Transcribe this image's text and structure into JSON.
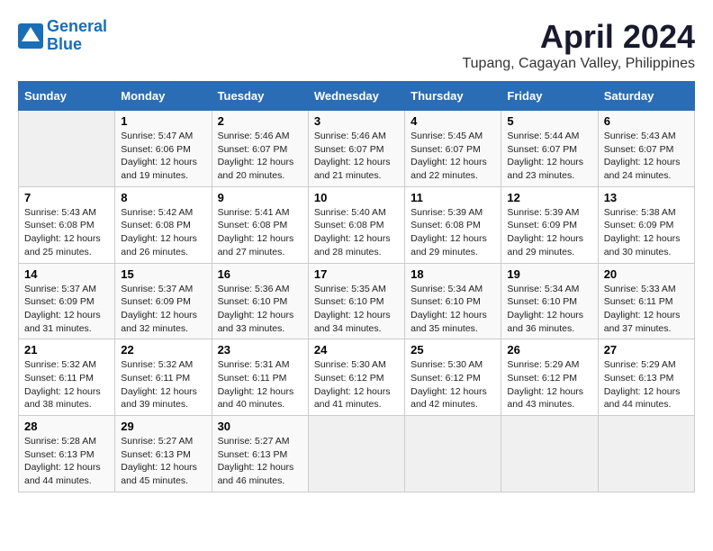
{
  "logo": {
    "line1": "General",
    "line2": "Blue"
  },
  "title": "April 2024",
  "location": "Tupang, Cagayan Valley, Philippines",
  "days_of_week": [
    "Sunday",
    "Monday",
    "Tuesday",
    "Wednesday",
    "Thursday",
    "Friday",
    "Saturday"
  ],
  "weeks": [
    [
      {
        "num": "",
        "info": ""
      },
      {
        "num": "1",
        "info": "Sunrise: 5:47 AM\nSunset: 6:06 PM\nDaylight: 12 hours\nand 19 minutes."
      },
      {
        "num": "2",
        "info": "Sunrise: 5:46 AM\nSunset: 6:07 PM\nDaylight: 12 hours\nand 20 minutes."
      },
      {
        "num": "3",
        "info": "Sunrise: 5:46 AM\nSunset: 6:07 PM\nDaylight: 12 hours\nand 21 minutes."
      },
      {
        "num": "4",
        "info": "Sunrise: 5:45 AM\nSunset: 6:07 PM\nDaylight: 12 hours\nand 22 minutes."
      },
      {
        "num": "5",
        "info": "Sunrise: 5:44 AM\nSunset: 6:07 PM\nDaylight: 12 hours\nand 23 minutes."
      },
      {
        "num": "6",
        "info": "Sunrise: 5:43 AM\nSunset: 6:07 PM\nDaylight: 12 hours\nand 24 minutes."
      }
    ],
    [
      {
        "num": "7",
        "info": "Sunrise: 5:43 AM\nSunset: 6:08 PM\nDaylight: 12 hours\nand 25 minutes."
      },
      {
        "num": "8",
        "info": "Sunrise: 5:42 AM\nSunset: 6:08 PM\nDaylight: 12 hours\nand 26 minutes."
      },
      {
        "num": "9",
        "info": "Sunrise: 5:41 AM\nSunset: 6:08 PM\nDaylight: 12 hours\nand 27 minutes."
      },
      {
        "num": "10",
        "info": "Sunrise: 5:40 AM\nSunset: 6:08 PM\nDaylight: 12 hours\nand 28 minutes."
      },
      {
        "num": "11",
        "info": "Sunrise: 5:39 AM\nSunset: 6:08 PM\nDaylight: 12 hours\nand 29 minutes."
      },
      {
        "num": "12",
        "info": "Sunrise: 5:39 AM\nSunset: 6:09 PM\nDaylight: 12 hours\nand 29 minutes."
      },
      {
        "num": "13",
        "info": "Sunrise: 5:38 AM\nSunset: 6:09 PM\nDaylight: 12 hours\nand 30 minutes."
      }
    ],
    [
      {
        "num": "14",
        "info": "Sunrise: 5:37 AM\nSunset: 6:09 PM\nDaylight: 12 hours\nand 31 minutes."
      },
      {
        "num": "15",
        "info": "Sunrise: 5:37 AM\nSunset: 6:09 PM\nDaylight: 12 hours\nand 32 minutes."
      },
      {
        "num": "16",
        "info": "Sunrise: 5:36 AM\nSunset: 6:10 PM\nDaylight: 12 hours\nand 33 minutes."
      },
      {
        "num": "17",
        "info": "Sunrise: 5:35 AM\nSunset: 6:10 PM\nDaylight: 12 hours\nand 34 minutes."
      },
      {
        "num": "18",
        "info": "Sunrise: 5:34 AM\nSunset: 6:10 PM\nDaylight: 12 hours\nand 35 minutes."
      },
      {
        "num": "19",
        "info": "Sunrise: 5:34 AM\nSunset: 6:10 PM\nDaylight: 12 hours\nand 36 minutes."
      },
      {
        "num": "20",
        "info": "Sunrise: 5:33 AM\nSunset: 6:11 PM\nDaylight: 12 hours\nand 37 minutes."
      }
    ],
    [
      {
        "num": "21",
        "info": "Sunrise: 5:32 AM\nSunset: 6:11 PM\nDaylight: 12 hours\nand 38 minutes."
      },
      {
        "num": "22",
        "info": "Sunrise: 5:32 AM\nSunset: 6:11 PM\nDaylight: 12 hours\nand 39 minutes."
      },
      {
        "num": "23",
        "info": "Sunrise: 5:31 AM\nSunset: 6:11 PM\nDaylight: 12 hours\nand 40 minutes."
      },
      {
        "num": "24",
        "info": "Sunrise: 5:30 AM\nSunset: 6:12 PM\nDaylight: 12 hours\nand 41 minutes."
      },
      {
        "num": "25",
        "info": "Sunrise: 5:30 AM\nSunset: 6:12 PM\nDaylight: 12 hours\nand 42 minutes."
      },
      {
        "num": "26",
        "info": "Sunrise: 5:29 AM\nSunset: 6:12 PM\nDaylight: 12 hours\nand 43 minutes."
      },
      {
        "num": "27",
        "info": "Sunrise: 5:29 AM\nSunset: 6:13 PM\nDaylight: 12 hours\nand 44 minutes."
      }
    ],
    [
      {
        "num": "28",
        "info": "Sunrise: 5:28 AM\nSunset: 6:13 PM\nDaylight: 12 hours\nand 44 minutes."
      },
      {
        "num": "29",
        "info": "Sunrise: 5:27 AM\nSunset: 6:13 PM\nDaylight: 12 hours\nand 45 minutes."
      },
      {
        "num": "30",
        "info": "Sunrise: 5:27 AM\nSunset: 6:13 PM\nDaylight: 12 hours\nand 46 minutes."
      },
      {
        "num": "",
        "info": ""
      },
      {
        "num": "",
        "info": ""
      },
      {
        "num": "",
        "info": ""
      },
      {
        "num": "",
        "info": ""
      }
    ]
  ]
}
